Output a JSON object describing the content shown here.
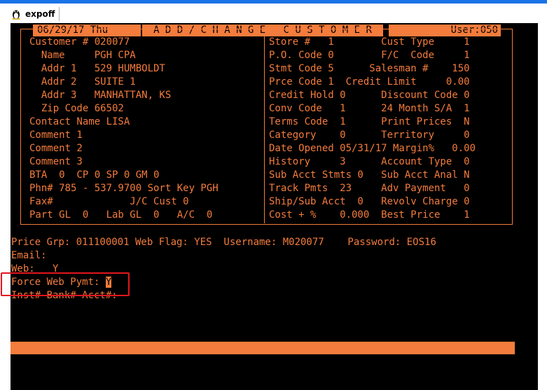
{
  "tab": {
    "title": "expoff"
  },
  "header": {
    "date": "06/29/17 Thu",
    "title": "A D D / C H A N G E   C U S T O M E R",
    "user": "User:050"
  },
  "left": [
    "Customer # 020077",
    "  Name     PGH CPA",
    "  Addr 1   529 HUMBOLDT",
    "  Addr 2   SUITE 1",
    "  Addr 3   MANHATTAN, KS",
    "  Zip Code 66502",
    "Contact Name LISA",
    "Comment 1",
    "Comment 2",
    "Comment 3",
    "BTA  0  CP 0 SP 0 GM 0",
    "Phn# 785 - 537.9700 Sort Key PGH",
    "Fax#             J/C Cust 0",
    "Part GL  0   Lab GL  0   A/C  0"
  ],
  "right": [
    "Store #   1        Cust Type     1",
    "P.O. Code 0        F/C  Code     1",
    "Stmt Code 5      Salesman #    150",
    "Prce Code 1  Credit Limit     0.00",
    "Credit Hold 0      Discount Code 0",
    "Conv Code   1      24 Month S/A  1",
    "Terms Code  1      Print Prices  N",
    "Category    0      Territory     0",
    "Date Opened 05/31/17 Margin%   0.00",
    "History     3      Account Type  0",
    "Sub Acct Stmts 0   Sub Acct Anal N",
    "Track Pmts  23     Adv Payment   0",
    "Ship/Sub Acct  0   Revolv Charge 0",
    "Cost + %    0.000  Best Price    1"
  ],
  "lower": {
    "price_line": "Price Grp: 011100001 Web Flag: YES  Username: M020077    Password: EOS16",
    "email": "Email:",
    "web": "Web:   Y",
    "force_label": "Force Web Pymt: ",
    "force_value": "Y",
    "inst": "Inst#-Bank#-Acct#:"
  }
}
